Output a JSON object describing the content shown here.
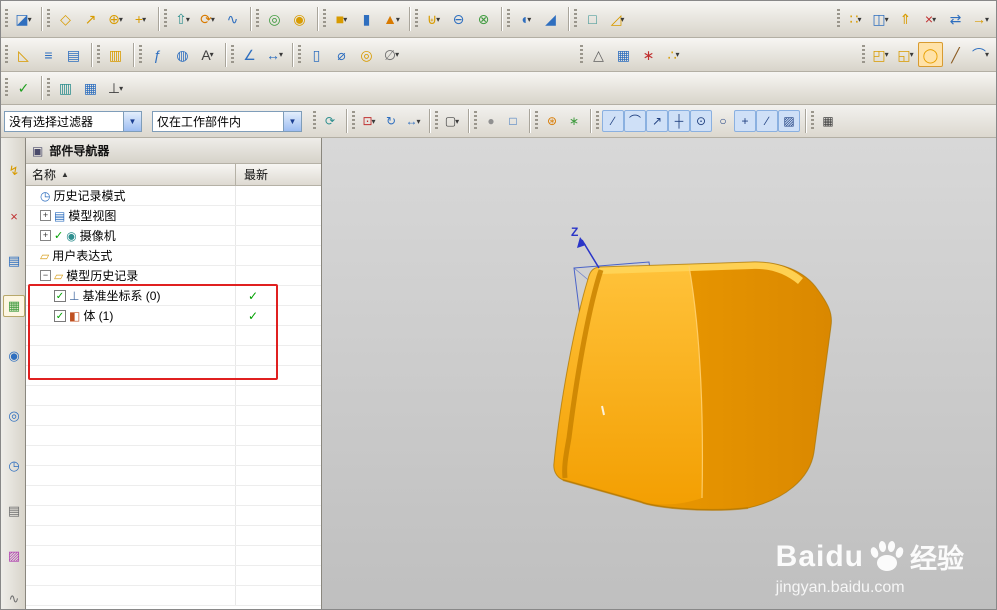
{
  "toolbars": {
    "row1": {
      "groups": [
        {
          "icons": [
            {
              "name": "sketch-icon",
              "glyph": "◪",
              "color": "#2f6fbf",
              "caret": true
            }
          ]
        },
        {
          "icons": [
            {
              "name": "datum-plane-icon",
              "glyph": "◇",
              "color": "#d89b00"
            },
            {
              "name": "datum-axis-icon",
              "glyph": "↗",
              "color": "#d89b00"
            },
            {
              "name": "datum-csys-icon",
              "glyph": "⊕",
              "color": "#d89b00",
              "caret": true
            },
            {
              "name": "point-icon",
              "glyph": "+",
              "color": "#d89b00",
              "caret": true
            }
          ]
        },
        {
          "icons": [
            {
              "name": "extrude-icon",
              "glyph": "⇧",
              "color": "#2f8f8f",
              "caret": true
            },
            {
              "name": "revolve-icon",
              "glyph": "⟳",
              "color": "#d87a00",
              "caret": true
            },
            {
              "name": "sweep-icon",
              "glyph": "∿",
              "color": "#2f6fbf"
            }
          ]
        },
        {
          "icons": [
            {
              "name": "hole-icon",
              "glyph": "◎",
              "color": "#3f9b3f"
            },
            {
              "name": "boss-icon",
              "glyph": "◉",
              "color": "#d89b00"
            }
          ]
        },
        {
          "icons": [
            {
              "name": "block-icon",
              "glyph": "■",
              "color": "#d89b00",
              "caret": true
            },
            {
              "name": "cylinder-icon",
              "glyph": "▮",
              "color": "#2f6fbf"
            },
            {
              "name": "cone-icon",
              "glyph": "▲",
              "color": "#d87a00",
              "caret": true
            }
          ]
        },
        {
          "icons": [
            {
              "name": "unite-icon",
              "glyph": "⊎",
              "color": "#d89b00",
              "caret": true
            },
            {
              "name": "subtract-icon",
              "glyph": "⊖",
              "color": "#2f6fbf"
            },
            {
              "name": "intersect-icon",
              "glyph": "⊗",
              "color": "#3f9b3f"
            }
          ]
        },
        {
          "icons": [
            {
              "name": "edge-blend-icon",
              "glyph": "◖",
              "color": "#2f6fbf",
              "caret": true
            },
            {
              "name": "chamfer-icon",
              "glyph": "◢",
              "color": "#2f6fbf"
            }
          ]
        },
        {
          "icons": [
            {
              "name": "shell-icon",
              "glyph": "□",
              "color": "#2f8f8f"
            },
            {
              "name": "draft-icon",
              "glyph": "◿",
              "color": "#d89b00",
              "caret": true
            }
          ]
        },
        {
          "push": true,
          "icons": [
            {
              "name": "pattern-feature-icon",
              "glyph": "∷",
              "color": "#d89b00",
              "caret": true
            },
            {
              "name": "mirror-feature-icon",
              "glyph": "◫",
              "color": "#2f6fbf",
              "caret": true
            },
            {
              "name": "offset-face-icon",
              "glyph": "⇑",
              "color": "#d89b00"
            },
            {
              "name": "delete-face-icon",
              "glyph": "×",
              "color": "#c03030",
              "caret": true
            },
            {
              "name": "replace-face-icon",
              "glyph": "⇄",
              "color": "#2f6fbf"
            },
            {
              "name": "move-face-icon",
              "glyph": "→",
              "color": "#d89b00",
              "caret": true
            }
          ]
        }
      ]
    },
    "row2": {
      "groups": [
        {
          "icons": [
            {
              "name": "sheet-body-icon",
              "glyph": "◺",
              "color": "#d89b00"
            },
            {
              "name": "layer-settings-icon",
              "glyph": "≡",
              "color": "#2f6fbf"
            },
            {
              "name": "layer-category-icon",
              "glyph": "▤",
              "color": "#2f6fbf"
            }
          ]
        },
        {
          "icons": [
            {
              "name": "information-icon",
              "glyph": "▥",
              "color": "#d89b00"
            }
          ]
        },
        {
          "icons": [
            {
              "name": "expression-icon",
              "glyph": "ƒ",
              "color": "#2f6fbf"
            },
            {
              "name": "macro-icon",
              "glyph": "◍",
              "color": "#2f6fbf"
            },
            {
              "name": "annotation-label-icon",
              "glyph": "A",
              "color": "#404040",
              "caret": true
            }
          ]
        },
        {
          "icons": [
            {
              "name": "measure-angle-icon",
              "glyph": "∠",
              "color": "#2f6fbf"
            },
            {
              "name": "measure-distance-icon",
              "glyph": "↔",
              "color": "#2f6fbf",
              "caret": true
            }
          ]
        },
        {
          "icons": [
            {
              "name": "tube-icon",
              "glyph": "▯",
              "color": "#2f6fbf"
            },
            {
              "name": "fastener-icon",
              "glyph": "⌀",
              "color": "#2f6fbf"
            },
            {
              "name": "washer-icon",
              "glyph": "◎",
              "color": "#d89b00"
            },
            {
              "name": "thread-icon",
              "glyph": "∅",
              "color": "#707070",
              "caret": true
            }
          ]
        },
        {
          "push": true,
          "icons": [
            {
              "name": "triangle-mesh-icon",
              "glyph": "△",
              "color": "#606060"
            },
            {
              "name": "data-table-icon",
              "glyph": "▦",
              "color": "#2f6fbf"
            },
            {
              "name": "pattern-grid-icon",
              "glyph": "∗",
              "color": "#c03030"
            },
            {
              "name": "point-set-icon",
              "glyph": "∴",
              "color": "#d89b00",
              "caret": true
            }
          ]
        },
        {
          "push": true,
          "icons": [
            {
              "name": "group-face-icon",
              "glyph": "◰",
              "color": "#d89b00",
              "caret": true
            },
            {
              "name": "bounded-plane-icon",
              "glyph": "◱",
              "color": "#d89b00",
              "caret": true
            },
            {
              "name": "highlight-ring-icon",
              "glyph": "◯",
              "color": "#e8a000",
              "active": true
            },
            {
              "name": "line-icon",
              "glyph": "╱",
              "color": "#8a5a20"
            },
            {
              "name": "arc-icon",
              "glyph": "⌒",
              "color": "#2f6fbf",
              "caret": true
            }
          ]
        }
      ]
    },
    "row3": {
      "groups": [
        {
          "icons": [
            {
              "name": "finish-check-icon",
              "glyph": "✓",
              "color": "#1f9f1f"
            }
          ]
        },
        {
          "icons": [
            {
              "name": "user-defined-view-icon",
              "glyph": "▥",
              "color": "#2f8f8f"
            },
            {
              "name": "visible-layers-icon",
              "glyph": "▦",
              "color": "#2f6fbf"
            },
            {
              "name": "orient-csys-icon",
              "glyph": "⊥",
              "color": "#404040",
              "caret": true
            }
          ]
        }
      ]
    }
  },
  "selection_bar": {
    "filter_combo": "没有选择过滤器",
    "scope_combo": "仅在工作部件内",
    "icons": {
      "groups": [
        {
          "icons": [
            {
              "name": "refresh-icon",
              "glyph": "⟳",
              "color": "#2f8f8f"
            }
          ]
        },
        {
          "icons": [
            {
              "name": "move-object-icon",
              "glyph": "⊡",
              "color": "#c03030",
              "caret": true
            },
            {
              "name": "rotate-view-icon",
              "glyph": "↻",
              "color": "#2f6fbf"
            },
            {
              "name": "pan-icon",
              "glyph": "↔",
              "color": "#2f6fbf",
              "caret": true
            }
          ]
        },
        {
          "icons": [
            {
              "name": "rectangle-select-icon",
              "glyph": "▢",
              "color": "#404040",
              "caret": true
            }
          ]
        },
        {
          "icons": [
            {
              "name": "shaded-view-icon",
              "glyph": "●",
              "color": "#909090"
            },
            {
              "name": "wireframe-view-icon",
              "glyph": "□",
              "color": "#2f6fbf"
            }
          ]
        },
        {
          "icons": [
            {
              "name": "assembly-colors-icon",
              "glyph": "⊛",
              "color": "#d87a00"
            },
            {
              "name": "component-group-icon",
              "glyph": "∗",
              "color": "#3f9b3f"
            }
          ]
        },
        {
          "icons": [
            {
              "name": "snap-endpoint-icon",
              "glyph": "∕",
              "color": "#204080",
              "active": true
            },
            {
              "name": "snap-midpoint-icon",
              "glyph": "⌒",
              "color": "#204080",
              "active": true
            },
            {
              "name": "snap-control-point-icon",
              "glyph": "↗",
              "color": "#204080",
              "active": true
            },
            {
              "name": "snap-intersection-icon",
              "glyph": "┼",
              "color": "#204080",
              "active": true
            },
            {
              "name": "snap-arc-center-icon",
              "glyph": "⊙",
              "color": "#204080",
              "active": true
            },
            {
              "name": "snap-quadrant-icon",
              "glyph": "○",
              "color": "#204080"
            },
            {
              "name": "snap-point-icon",
              "glyph": "+",
              "color": "#204080",
              "active": true
            },
            {
              "name": "snap-on-curve-icon",
              "glyph": "∕",
              "color": "#204080",
              "active": true
            },
            {
              "name": "snap-on-face-icon",
              "glyph": "▨",
              "color": "#204080",
              "active": true
            }
          ]
        },
        {
          "icons": [
            {
              "name": "grid-snap-icon",
              "glyph": "▦",
              "color": "#404040"
            }
          ]
        }
      ]
    }
  },
  "sidebar": {
    "tabs": [
      {
        "name": "assembly-navigator-tab",
        "glyph": "↯",
        "color": "#d89b00"
      },
      {
        "name": "constraint-navigator-tab",
        "glyph": "×",
        "color": "#c03030"
      },
      {
        "name": "part-navigator-tab",
        "glyph": "▤",
        "color": "#2f6fbf"
      },
      {
        "name": "reuse-library-tab",
        "glyph": "▦",
        "color": "#3f9b3f",
        "active": true
      },
      {
        "name": "web-browser-tab",
        "glyph": "◉",
        "color": "#2f6fbf"
      },
      {
        "name": "history-palette-tab",
        "glyph": "◎",
        "color": "#2f6fbf"
      },
      {
        "name": "system-clock-tab",
        "glyph": "◷",
        "color": "#2f6fbf"
      },
      {
        "name": "document-tab",
        "glyph": "▤",
        "color": "#707070"
      },
      {
        "name": "palette-tab",
        "glyph": "▨",
        "color": "#b040b0"
      },
      {
        "name": "tools-tab",
        "glyph": "∿",
        "color": "#707070"
      }
    ]
  },
  "navigator": {
    "title": "部件导航器",
    "columns": [
      {
        "label": "名称",
        "sort": "▲"
      },
      {
        "label": "最新"
      }
    ],
    "items": [
      {
        "id": "history-mode",
        "label": "历史记录模式",
        "icon_glyph": "◷",
        "icon_color": "#2f6fbf"
      },
      {
        "id": "model-views",
        "label": "模型视图",
        "icon_glyph": "▤",
        "icon_color": "#2f6fbf",
        "expander": "+"
      },
      {
        "id": "cameras",
        "label": "摄像机",
        "icon_glyph": "◉",
        "icon_color": "#2f8f8f",
        "expander": "+",
        "pre_check": true
      },
      {
        "id": "user-expressions",
        "label": "用户表达式",
        "icon_glyph": "▱",
        "icon_color": "#d8a020"
      },
      {
        "id": "model-history",
        "label": "模型历史记录",
        "icon_glyph": "▱",
        "icon_color": "#d8a020",
        "expander": "-"
      },
      {
        "id": "datum-csys",
        "label": "基准坐标系 (0)",
        "icon_glyph": "⊥",
        "icon_color": "#4a6fa5",
        "indent": 1,
        "checkbox": true,
        "latest_check": true
      },
      {
        "id": "body",
        "label": "体 (1)",
        "icon_glyph": "◧",
        "icon_color": "#c05020",
        "indent": 1,
        "checkbox": true,
        "latest_check": true
      }
    ],
    "empty_row_count": 14,
    "check_glyph": "✓",
    "check_color": "#00a000",
    "highlight_color": "#e02020"
  },
  "viewport": {
    "z_axis_label": "Z",
    "model_color": "#f5a300",
    "axis_color": "#2a35c8"
  },
  "watermark": {
    "brand": "Baidu",
    "suffix": "经验",
    "url": "jingyan.baidu.com"
  }
}
